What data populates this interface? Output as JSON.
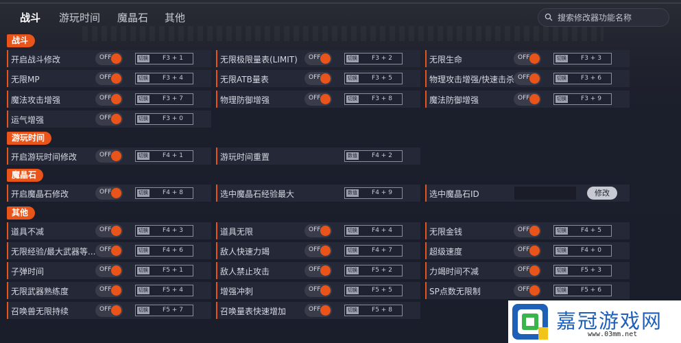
{
  "tabs": [
    "战斗",
    "游玩时间",
    "魔晶石",
    "其他"
  ],
  "search": {
    "placeholder": "搜索修改器功能名称"
  },
  "toggle_text": "OFF",
  "key_badge": "切换",
  "key_badge_alt": "数值",
  "edit_label": "修改",
  "colors": {
    "accent": "#e9541a",
    "background": "#1c1f2c",
    "row": "#252837"
  },
  "sections": {
    "battle": {
      "title": "战斗",
      "items": [
        {
          "label": "开启战斗修改",
          "key": "F3 + 1"
        },
        {
          "label": "无限极限量表(LIMIT)",
          "key": "F3 + 2"
        },
        {
          "label": "无限生命",
          "key": "F3 + 3"
        },
        {
          "label": "无限MP",
          "key": "F3 + 4"
        },
        {
          "label": "无限ATB量表",
          "key": "F3 + 5"
        },
        {
          "label": "物理攻击增强/快速击杀",
          "key": "F3 + 6"
        },
        {
          "label": "魔法攻击增强",
          "key": "F3 + 7"
        },
        {
          "label": "物理防御增强",
          "key": "F3 + 8"
        },
        {
          "label": "魔法防御增强",
          "key": "F3 + 9"
        },
        {
          "label": "运气增强",
          "key": "F3 + 0"
        }
      ]
    },
    "playtime": {
      "title": "游玩时间",
      "items": [
        {
          "label": "开启游玩时间修改",
          "key": "F4 + 1"
        },
        {
          "label": "游玩时间重置",
          "key": "F4 + 2"
        }
      ]
    },
    "materia": {
      "title": "魔晶石",
      "items": [
        {
          "label": "开启魔晶石修改",
          "key": "F4 + 8"
        },
        {
          "label": "选中魔晶石经验最大",
          "key": "F4 + 9"
        },
        {
          "label": "选中魔晶石ID"
        }
      ]
    },
    "other": {
      "title": "其他",
      "items": [
        {
          "label": "道具不减",
          "key": "F4 + 3"
        },
        {
          "label": "道具无限",
          "key": "F4 + 4"
        },
        {
          "label": "无限金钱",
          "key": "F4 + 5"
        },
        {
          "label": "无限经验/最大武器等...",
          "key": "F4 + 6"
        },
        {
          "label": "敌人快速力竭",
          "key": "F4 + 7"
        },
        {
          "label": "超级速度",
          "key": "F4 + 0"
        },
        {
          "label": "子弹时间",
          "key": "F5 + 1"
        },
        {
          "label": "敌人禁止攻击",
          "key": "F5 + 2"
        },
        {
          "label": "力竭时间不减",
          "key": "F5 + 3"
        },
        {
          "label": "无限武器熟练度",
          "key": "F5 + 4"
        },
        {
          "label": "增强冲刺",
          "key": "F5 + 5"
        },
        {
          "label": "SP点数无限制",
          "key": "F5 + 6"
        },
        {
          "label": "召唤兽无限持续",
          "key": "F5 + 7"
        },
        {
          "label": "召唤量表快速增加",
          "key": "F5 + 8"
        }
      ]
    }
  },
  "logo": {
    "text": "嘉冠游戏网",
    "url": "www.03mm.net"
  }
}
